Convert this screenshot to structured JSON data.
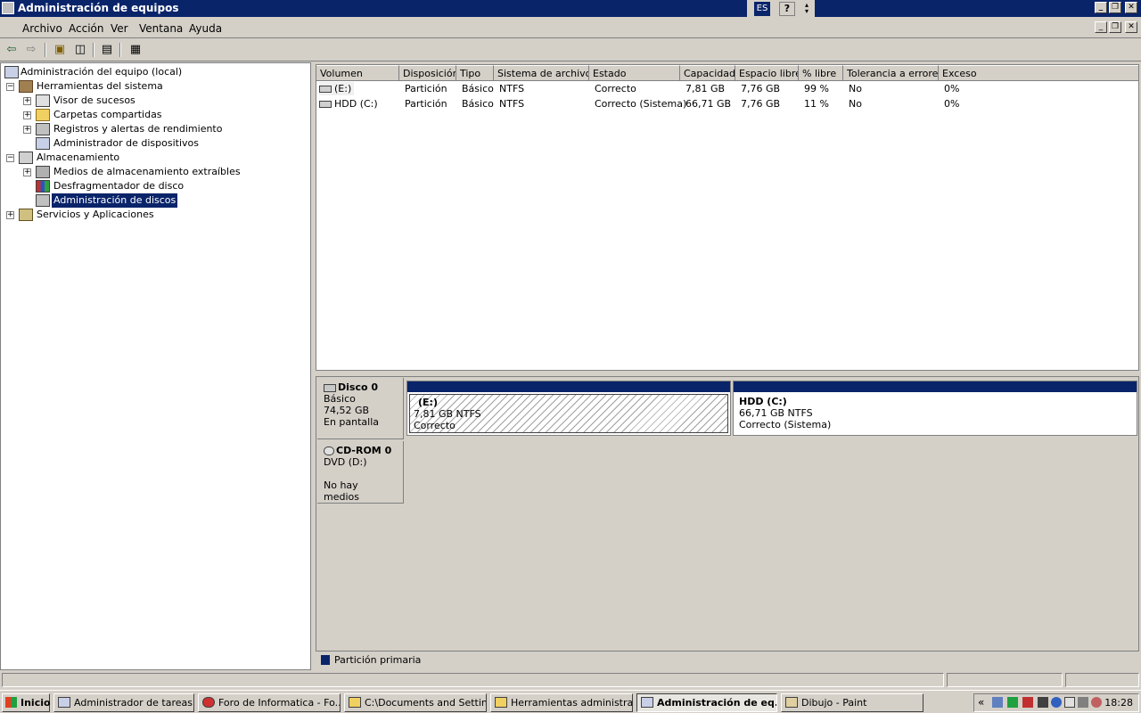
{
  "window": {
    "title": "Administración de equipos",
    "lang": "ES",
    "help": "?",
    "minimize": "_",
    "restore": "❐",
    "close": "✕"
  },
  "menu": [
    "Archivo",
    "Acción",
    "Ver",
    "Ventana",
    "Ayuda"
  ],
  "toolbar": {
    "buttons": [
      "back-icon",
      "forward-icon",
      "up-folder-icon",
      "show-hide-tree-icon",
      "properties-icon",
      "help-icon"
    ]
  },
  "tree": {
    "root": "Administración del equipo (local)",
    "system_tools": "Herramientas del sistema",
    "event_viewer": "Visor de sucesos",
    "shared_folders": "Carpetas compartidas",
    "perf_logs": "Registros y alertas de rendimiento",
    "device_manager": "Administrador de dispositivos",
    "storage": "Almacenamiento",
    "removable_storage": "Medios de almacenamiento extraíbles",
    "defrag": "Desfragmentador de disco",
    "disk_management": "Administración de discos",
    "services_apps": "Servicios y Aplicaciones"
  },
  "volumes": {
    "columns": [
      "Volumen",
      "Disposición",
      "Tipo",
      "Sistema de archivos",
      "Estado",
      "Capacidad",
      "Espacio libre",
      "% libre",
      "Tolerancia a errores",
      "Exceso"
    ],
    "rows": [
      [
        "(E:)",
        "Partición",
        "Básico",
        "NTFS",
        "Correcto",
        "7,81 GB",
        "7,76 GB",
        "99 %",
        "No",
        "0%"
      ],
      [
        "HDD (C:)",
        "Partición",
        "Básico",
        "NTFS",
        "Correcto (Sistema)",
        "66,71 GB",
        "7,76 GB",
        "11 %",
        "No",
        "0%"
      ]
    ]
  },
  "disks": {
    "disk0": {
      "name": "Disco 0",
      "type": "Básico",
      "size": "74,52 GB",
      "status": "En pantalla",
      "partitions": [
        {
          "name": "(E:)",
          "size": "7,81 GB NTFS",
          "status": "Correcto"
        },
        {
          "name": "HDD  (C:)",
          "size": "66,71 GB NTFS",
          "status": "Correcto (Sistema)"
        }
      ]
    },
    "cdrom0": {
      "name": "CD-ROM 0",
      "type": "DVD (D:)",
      "status": "No hay medios"
    }
  },
  "legend": {
    "primary": "Partición primaria",
    "primary_color": "#0a246a"
  },
  "taskbar": {
    "start": "Inicio",
    "tasks": [
      "Administrador de tareas ...",
      "Foro de Informatica - Fo...",
      "C:\\Documents and Settin...",
      "Herramientas administrat...",
      "Administración de eq...",
      "Dibujo - Paint"
    ],
    "tray_chevron": "«",
    "clock": "18:28"
  },
  "colors": {
    "titlebar": "#0a246a",
    "selection": "#0a246a",
    "face": "#d4d0c8"
  }
}
